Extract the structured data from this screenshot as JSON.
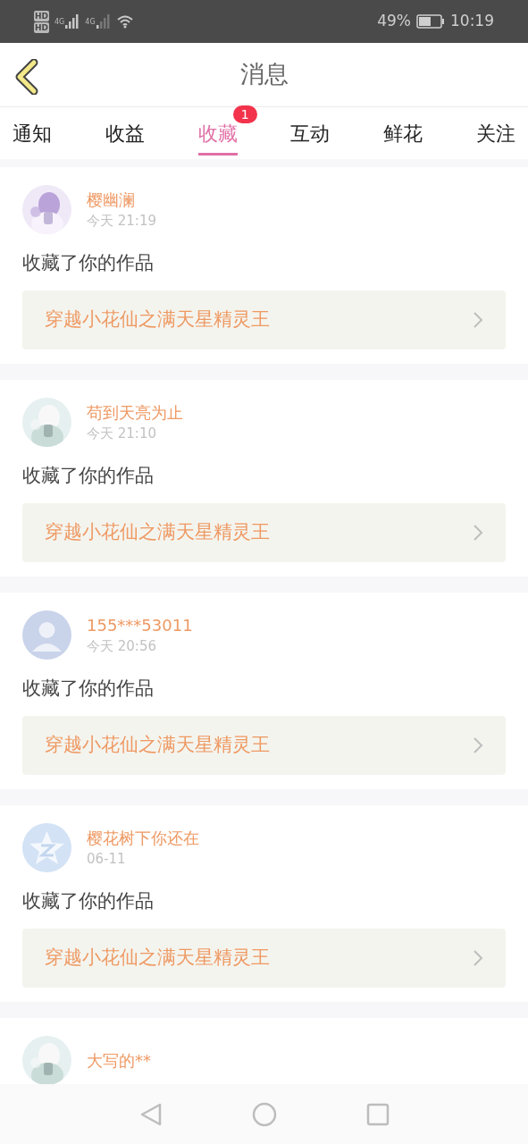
{
  "status_bar": {
    "sims": [
      {
        "label": "HD",
        "network": "4G"
      },
      {
        "label": "HD",
        "network": "4G"
      }
    ],
    "battery": "49%",
    "time": "10:19"
  },
  "header": {
    "title": "消息"
  },
  "tabs": [
    {
      "label": "通知",
      "selected": false
    },
    {
      "label": "收益",
      "selected": false
    },
    {
      "label": "收藏",
      "selected": true,
      "badge": "1"
    },
    {
      "label": "互动",
      "selected": false
    },
    {
      "label": "鲜花",
      "selected": false
    },
    {
      "label": "关注",
      "selected": false
    }
  ],
  "messages": [
    {
      "kind": "picture",
      "name": "樱幽澜",
      "time": "今天 21:19",
      "action": "收藏了你的作品",
      "work": "穿越小花仙之满天星精灵王"
    },
    {
      "kind": "picture",
      "name": "苟到天亮为止",
      "time": "今天 21:10",
      "action": "收藏了你的作品",
      "work": "穿越小花仙之满天星精灵王"
    },
    {
      "kind": "silhouette",
      "name": "155***53011",
      "time": "今天 20:56",
      "action": "收藏了你的作品",
      "work": "穿越小花仙之满天星精灵王"
    },
    {
      "kind": "logo",
      "name": "樱花树下你还在",
      "time": "06-11",
      "action": "收藏了你的作品",
      "work": "穿越小花仙之满天星精灵王"
    },
    {
      "kind": "picture",
      "name": "大写的**"
    }
  ]
}
